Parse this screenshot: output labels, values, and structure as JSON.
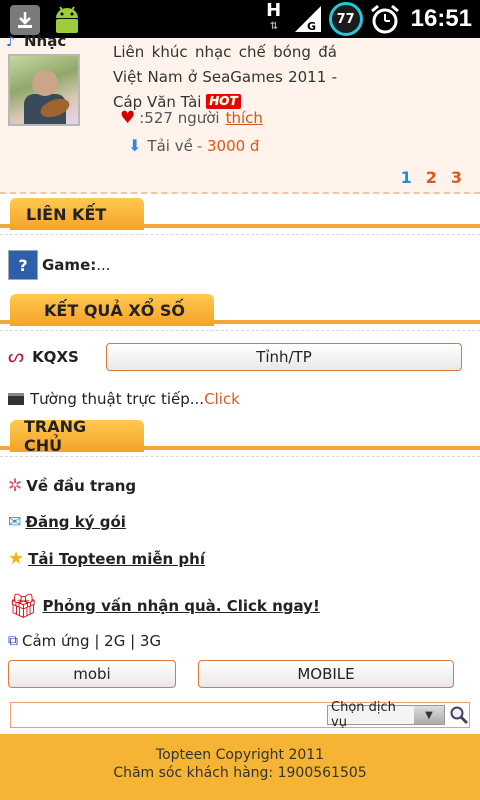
{
  "status_bar": {
    "network_type": "H",
    "signal_label": "G",
    "battery_level": "77",
    "time": "16:51"
  },
  "product": {
    "category": "Nhạc",
    "title": "Liên khúc nhạc chế bóng đá Việt Nam ở SeaGames 2011 - Cáp Văn Tài",
    "hot_badge": "HOT",
    "likes_count": ":527 người",
    "like_link": "thích",
    "download_label": "Tải về",
    "download_price": "- 3000 đ"
  },
  "pager": {
    "pages": [
      "1",
      "2",
      "3"
    ],
    "current": "1"
  },
  "sections": {
    "links": "LIÊN KẾT",
    "lottery": "KẾT QUẢ XỔ SỐ",
    "home": "TRANG CHỦ"
  },
  "links": {
    "game_label": "Game:",
    "game_value": "..."
  },
  "lottery": {
    "kqxs_label": "KQXS",
    "province_button": "Tỉnh/TP",
    "live_text": "Tường thuật trực tiếp...",
    "live_link": "Click"
  },
  "home": {
    "top_link": "Về đầu trang",
    "register_link": "Đăng ký gói",
    "download_topteen": "Tải Topteen miễn phí",
    "interview_link": "Phỏng vấn nhận quà. Click ngay!",
    "touch_text": "Cảm ứng | 2G | 3G",
    "mobi_button": "mobi",
    "mobile_button": "MOBILE"
  },
  "search": {
    "select_value": "Chọn dịch vụ"
  },
  "footer": {
    "copyright": "Topteen Copyright 2011",
    "support": "Chăm sóc khách hàng: 1900561505"
  },
  "colors": {
    "accent": "#f6a63d",
    "link_orange": "#e0561c",
    "page_blue": "#1a8fd6",
    "footer_bg": "#f6b434"
  }
}
